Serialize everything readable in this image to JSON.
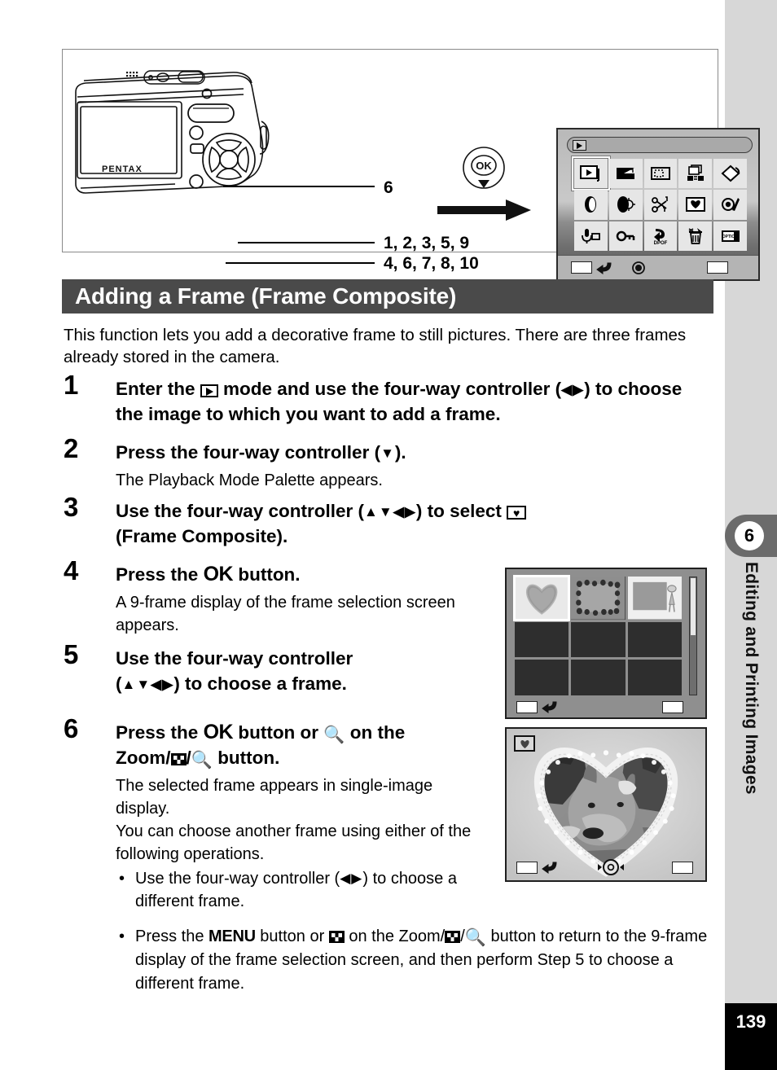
{
  "page": {
    "number": "139",
    "chapter_number": "6",
    "chapter_title": "Editing and Printing Images"
  },
  "figure": {
    "camera_brand": "PENTAX",
    "callouts": {
      "zoom_button": "6",
      "four_way_horizontal": "1, 2, 3, 5, 9",
      "four_way_vertical": "4, 6, 7, 8, 10"
    },
    "ok_button_label": "OK",
    "palette": {
      "icons": [
        "slideshow-icon",
        "resize-icon",
        "cropping-icon",
        "image-copy-icon",
        "image-rotation-icon",
        "digital-filter-icon",
        "brightness-filter-icon",
        "movie-edit-icon",
        "frame-composite-icon",
        "red-eye-compensation-icon",
        "voice-memo-icon",
        "protect-icon",
        "dpof-icon",
        "delete-icon",
        "start-up-screen-icon"
      ],
      "selected_index": 0
    }
  },
  "section": {
    "title": "Adding a Frame (Frame Composite)",
    "intro": "This function lets you add a decorative frame to still pictures. There are three frames already stored in the camera."
  },
  "steps": [
    {
      "number": "1",
      "head_parts": [
        "Enter the ",
        "PLAYBACK_ICON",
        " mode and use the four-way controller (",
        "LEFT_RIGHT",
        ") to choose the image to which you want to add a frame."
      ],
      "head_text_a": "Enter the",
      "head_text_b": "mode and use the four-way controller (",
      "head_text_c": ") to choose the image to which you want to add a frame.",
      "desc": ""
    },
    {
      "number": "2",
      "head_text_a": "Press the four-way controller (",
      "head_text_c": ").",
      "desc": "The Playback Mode Palette appears."
    },
    {
      "number": "3",
      "head_text_a": "Use the four-way controller (",
      "head_text_b": ") to select",
      "head_text_c": "(Frame Composite).",
      "desc": ""
    },
    {
      "number": "4",
      "head_text_a": "Press the",
      "head_text_b": "OK",
      "head_text_c": "button.",
      "desc": "A 9-frame display of the frame selection screen appears."
    },
    {
      "number": "5",
      "head_text_a": "Use the four-way controller",
      "head_text_b": "(",
      "head_text_c": ") to choose a frame.",
      "desc": ""
    },
    {
      "number": "6",
      "head_text_a": "Press the",
      "head_text_b": "OK",
      "head_text_c": "button or",
      "head_text_d": "on the",
      "head_text_e": "Zoom/",
      "head_text_f": "button.",
      "desc_line1": "The selected frame appears in single-image display.",
      "desc_line2": "You can choose another frame using either of the following operations.",
      "bullets": {
        "b1_a": "Use the four-way controller (",
        "b1_b": ") to choose a different frame.",
        "b2_a": "Press the",
        "b2_menu": "MENU",
        "b2_b": "button or",
        "b2_c": "on the Zoom/",
        "b2_d": "button to return to the 9-frame display of the frame selection screen, and then perform Step 5 to choose a different frame."
      }
    }
  ],
  "screens": {
    "frame_selection": {
      "name": "9-frame frame selection screen",
      "selected_cell": 0,
      "thumbnail_count": 3
    },
    "single_image": {
      "name": "single-image display with heart frame",
      "badge": "heart-frame-badge"
    }
  },
  "colors": {
    "title_bar": "#4a4a4a",
    "rail": "#d7d7d7",
    "chapter_tab": "#6b6b6b",
    "page_number_bg": "#000000"
  }
}
